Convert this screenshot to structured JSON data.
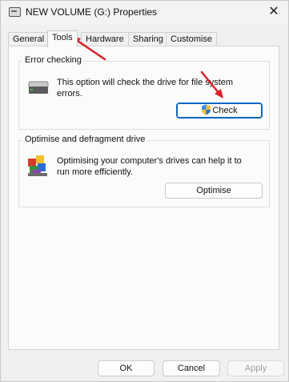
{
  "window": {
    "title": "NEW VOLUME (G:) Properties",
    "close_glyph": "✕"
  },
  "tabs": [
    {
      "label": "General"
    },
    {
      "label": "Tools"
    },
    {
      "label": "Hardware"
    },
    {
      "label": "Sharing"
    },
    {
      "label": "Customise"
    }
  ],
  "error_checking": {
    "title": "Error checking",
    "description": "This option will check the drive for file system errors.",
    "button_label": "Check"
  },
  "optimise": {
    "title": "Optimise and defragment drive",
    "description": "Optimising your computer's drives can help it to run more efficiently.",
    "button_label": "Optimise"
  },
  "footer": {
    "ok": "OK",
    "cancel": "Cancel",
    "apply": "Apply"
  },
  "colors": {
    "annotation_arrow": "#d8202a",
    "accent": "#0e67c2"
  }
}
